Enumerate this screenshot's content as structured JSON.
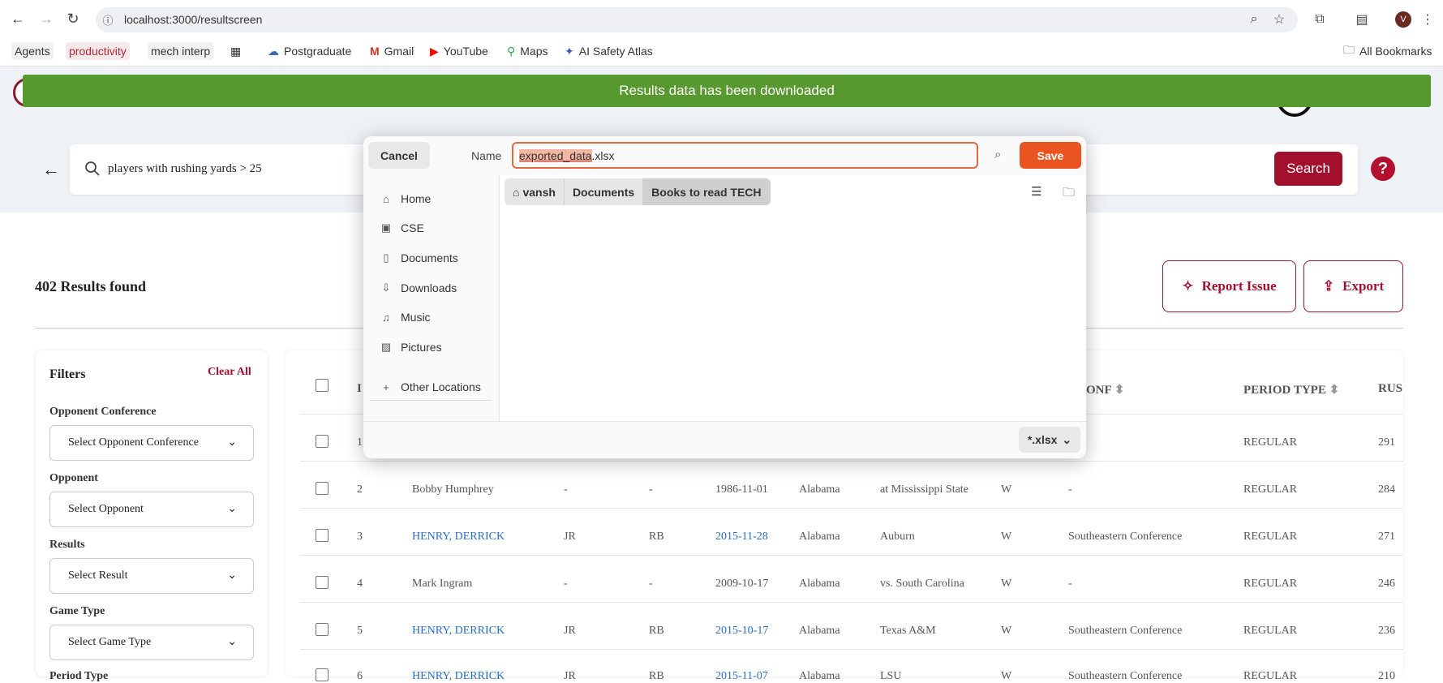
{
  "browser": {
    "url": "localhost:3000/resultscreen",
    "avatar_letter": "V",
    "bookmarks": [
      "Agents",
      "productivity",
      "mech interp",
      "Postgraduate",
      "Gmail",
      "YouTube",
      "Maps",
      "AI Safety Atlas"
    ],
    "all_bookmarks": "All Bookmarks"
  },
  "toast": "Results data has been downloaded",
  "search": {
    "query": "players with rushing yards > 25",
    "button": "Search",
    "help": "?"
  },
  "results": {
    "count_text": "402 Results found",
    "report_label": "Report Issue",
    "export_label": "Export"
  },
  "filters": {
    "title": "Filters",
    "clear": "Clear All",
    "groups": [
      {
        "label": "Opponent Conference",
        "placeholder": "Select Opponent Conference"
      },
      {
        "label": "Opponent",
        "placeholder": "Select Opponent"
      },
      {
        "label": "Results",
        "placeholder": "Select Result"
      },
      {
        "label": "Game Type",
        "placeholder": "Select Game Type"
      }
    ],
    "cut_label": "Period Type"
  },
  "table": {
    "headers": {
      "id": "I",
      "conf": "ONF",
      "period": "PERIOD TYPE",
      "rush": "RUS"
    },
    "rows": [
      {
        "n": "1",
        "name": "",
        "cls": "",
        "pos": "",
        "date": "",
        "team": "",
        "opp": "",
        "res": "",
        "conf": "",
        "period": "REGULAR",
        "rush": "291"
      },
      {
        "n": "2",
        "name": "Bobby Humphrey",
        "cls": "-",
        "pos": "-",
        "date": "1986-11-01",
        "team": "Alabama",
        "opp": "at Mississippi State",
        "res": "W",
        "conf": "-",
        "period": "REGULAR",
        "rush": "284"
      },
      {
        "n": "3",
        "name": "HENRY, DERRICK",
        "cls": "JR",
        "pos": "RB",
        "date": "2015-11-28",
        "team": "Alabama",
        "opp": "Auburn",
        "res": "W",
        "conf": "Southeastern Conference",
        "period": "REGULAR",
        "rush": "271"
      },
      {
        "n": "4",
        "name": "Mark Ingram",
        "cls": "-",
        "pos": "-",
        "date": "2009-10-17",
        "team": "Alabama",
        "opp": "vs. South Carolina",
        "res": "W",
        "conf": "-",
        "period": "REGULAR",
        "rush": "246"
      },
      {
        "n": "5",
        "name": "HENRY, DERRICK",
        "cls": "JR",
        "pos": "RB",
        "date": "2015-10-17",
        "team": "Alabama",
        "opp": "Texas A&M",
        "res": "W",
        "conf": "Southeastern Conference",
        "period": "REGULAR",
        "rush": "236"
      },
      {
        "n": "6",
        "name": "HENRY, DERRICK",
        "cls": "JR",
        "pos": "RB",
        "date": "2015-11-07",
        "team": "Alabama",
        "opp": "LSU",
        "res": "W",
        "conf": "Southeastern Conference",
        "period": "REGULAR",
        "rush": "210"
      }
    ]
  },
  "dialog": {
    "cancel": "Cancel",
    "name_label": "Name",
    "filename_selected": "exported_data",
    "filename_ext": ".xlsx",
    "save": "Save",
    "places": [
      "Home",
      "CSE",
      "Documents",
      "Downloads",
      "Music",
      "Pictures"
    ],
    "other_locations": "Other Locations",
    "crumbs": [
      "vansh",
      "Documents",
      "Books to read TECH"
    ],
    "filter": "*.xlsx"
  }
}
